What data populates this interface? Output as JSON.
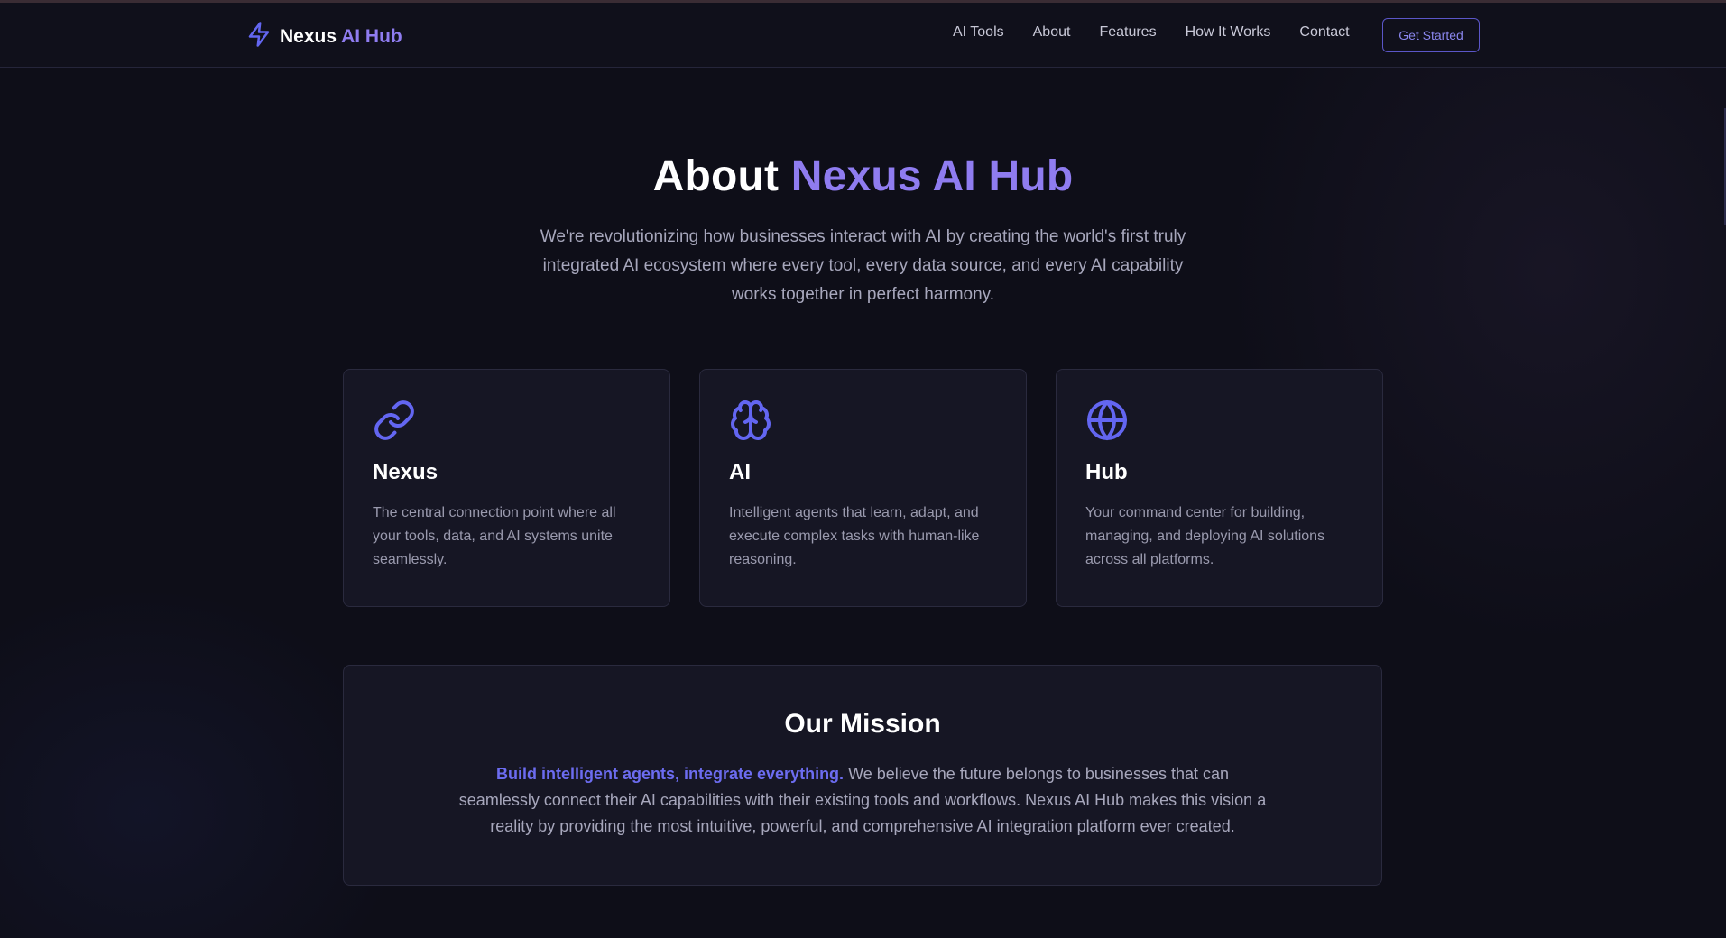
{
  "header": {
    "logo_icon": "lightning-bolt-icon",
    "logo_name": "Nexus",
    "logo_accent": "AI Hub",
    "nav": [
      "AI Tools",
      "About",
      "Features",
      "How It Works",
      "Contact"
    ],
    "cta": "Get Started"
  },
  "hero": {
    "title_main": "About",
    "title_accent": "Nexus AI Hub",
    "subtitle": "We're revolutionizing how businesses interact with AI by creating the world's first truly integrated AI ecosystem where every tool, every data source, and every AI capability works together in perfect harmony."
  },
  "cards": [
    {
      "icon": "link-icon",
      "title": "Nexus",
      "text": "The central connection point where all your tools, data, and AI systems unite seamlessly."
    },
    {
      "icon": "brain-icon",
      "title": "AI",
      "text": "Intelligent agents that learn, adapt, and execute complex tasks with human-like reasoning."
    },
    {
      "icon": "globe-icon",
      "title": "Hub",
      "text": "Your command center for building, managing, and deploying AI solutions across all platforms."
    }
  ],
  "mission": {
    "title": "Our Mission",
    "highlight": "Build intelligent agents, integrate everything.",
    "body": " We believe the future belongs to businesses that can seamlessly connect their AI capabilities with their existing tools and workflows. Nexus AI Hub makes this vision a reality by providing the most intuitive, powerful, and comprehensive AI integration platform ever created."
  },
  "colors": {
    "accent": "#8f7cf0",
    "icon": "#6366f1",
    "background": "#0e0e18",
    "card": "#161624"
  }
}
